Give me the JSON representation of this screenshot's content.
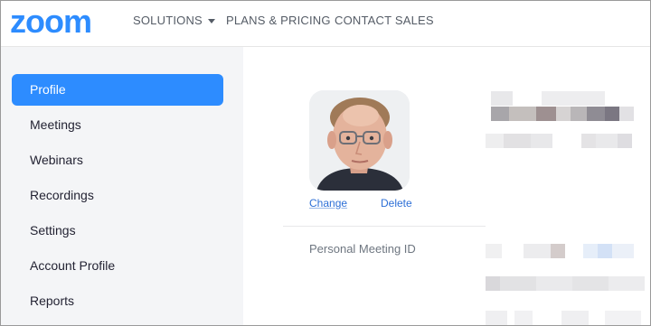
{
  "brand": {
    "logo_text": "zoom",
    "color": "#2d8cff"
  },
  "nav": {
    "items": [
      {
        "label": "SOLUTIONS",
        "has_dropdown": true
      },
      {
        "label": "PLANS & PRICING",
        "has_dropdown": false
      },
      {
        "label": "CONTACT SALES",
        "has_dropdown": false
      }
    ]
  },
  "sidebar": {
    "items": [
      {
        "label": "Profile",
        "active": true
      },
      {
        "label": "Meetings",
        "active": false
      },
      {
        "label": "Webinars",
        "active": false
      },
      {
        "label": "Recordings",
        "active": false
      },
      {
        "label": "Settings",
        "active": false
      },
      {
        "label": "Account Profile",
        "active": false
      },
      {
        "label": "Reports",
        "active": false
      }
    ]
  },
  "profile": {
    "photo_actions": {
      "change": "Change",
      "delete": "Delete"
    },
    "personal_meeting_id_label": "Personal Meeting ID"
  },
  "colors": {
    "accent": "#2d8cff",
    "sidebar_bg": "#f4f5f7",
    "text": "#232333"
  }
}
